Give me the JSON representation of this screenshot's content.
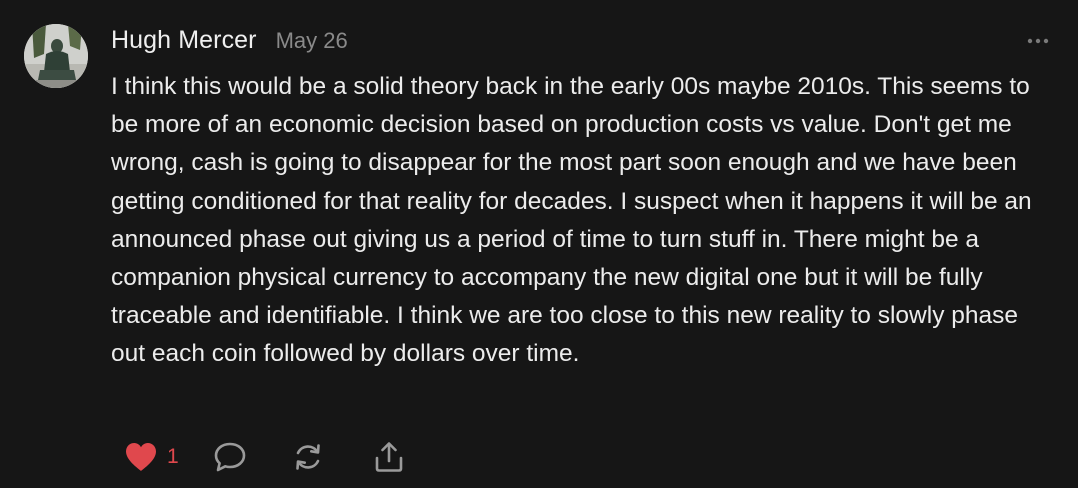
{
  "comment": {
    "author": "Hugh Mercer",
    "date": "May 26",
    "text": "I think this would be a solid theory back in the early 00s maybe 2010s. This seems to be more of an economic decision based on production costs vs value. Don't get me wrong, cash is going to disappear for the most part soon enough and we have been getting conditioned for that reality for decades. I suspect when it happens it will be an announced phase out giving us a period of time to turn stuff in. There might be a companion physical currency to accompany the new digital one but it will be fully traceable and identifiable. I think we are too close to this new reality to slowly phase out each coin followed by dollars over time.",
    "likes": "1",
    "liked": true
  },
  "icons": {
    "like": "heart-icon",
    "reply": "speech-bubble-icon",
    "restack": "repost-arrows-icon",
    "share": "share-upload-icon",
    "menu": "ellipsis-icon"
  },
  "colors": {
    "background": "#161616",
    "text": "#ececec",
    "muted": "#8a8a8a",
    "like": "#e0484d",
    "icon": "#9a9a9a"
  }
}
